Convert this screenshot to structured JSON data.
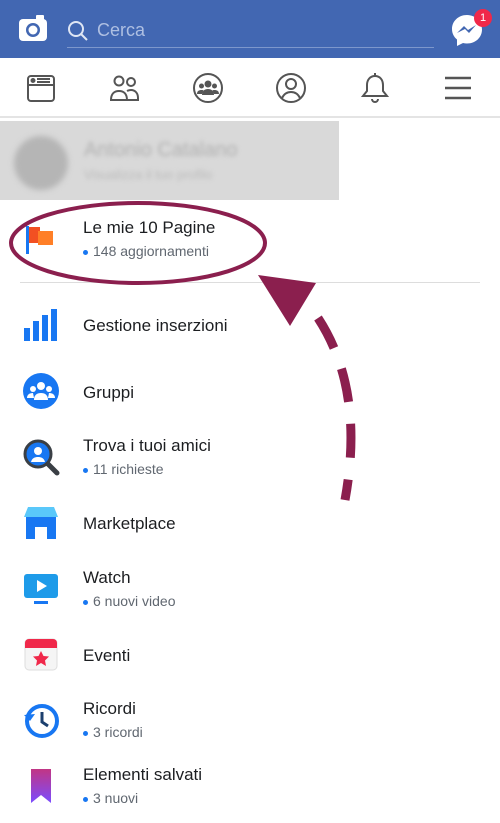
{
  "header": {
    "search_placeholder": "Cerca",
    "messenger_badge": "1",
    "color": "#4267b2"
  },
  "nav": [
    "news-feed-icon",
    "friends-icon",
    "groups-icon",
    "profile-icon",
    "bell-icon",
    "menu-icon"
  ],
  "profile": {
    "name": "Antonio Catalano",
    "subtitle": "Visualizza il tuo profilo"
  },
  "items": [
    {
      "title": "Le mie 10 Pagine",
      "sub": "148 aggiornamenti",
      "icon": "flag-icon"
    },
    {
      "title": "Gestione inserzioni",
      "icon": "bar-chart-icon"
    },
    {
      "title": "Gruppi",
      "icon": "groups-icon"
    },
    {
      "title": "Trova i tuoi amici",
      "sub": "11 richieste",
      "icon": "find-friends-icon"
    },
    {
      "title": "Marketplace",
      "icon": "store-icon"
    },
    {
      "title": "Watch",
      "sub": "6 nuovi video",
      "icon": "video-icon"
    },
    {
      "title": "Eventi",
      "icon": "calendar-icon"
    },
    {
      "title": "Ricordi",
      "sub": "3 ricordi",
      "icon": "clock-icon"
    },
    {
      "title": "Elementi salvati",
      "sub": "3 nuovi",
      "icon": "bookmark-icon"
    }
  ],
  "annotation_color": "#8b1f4e"
}
